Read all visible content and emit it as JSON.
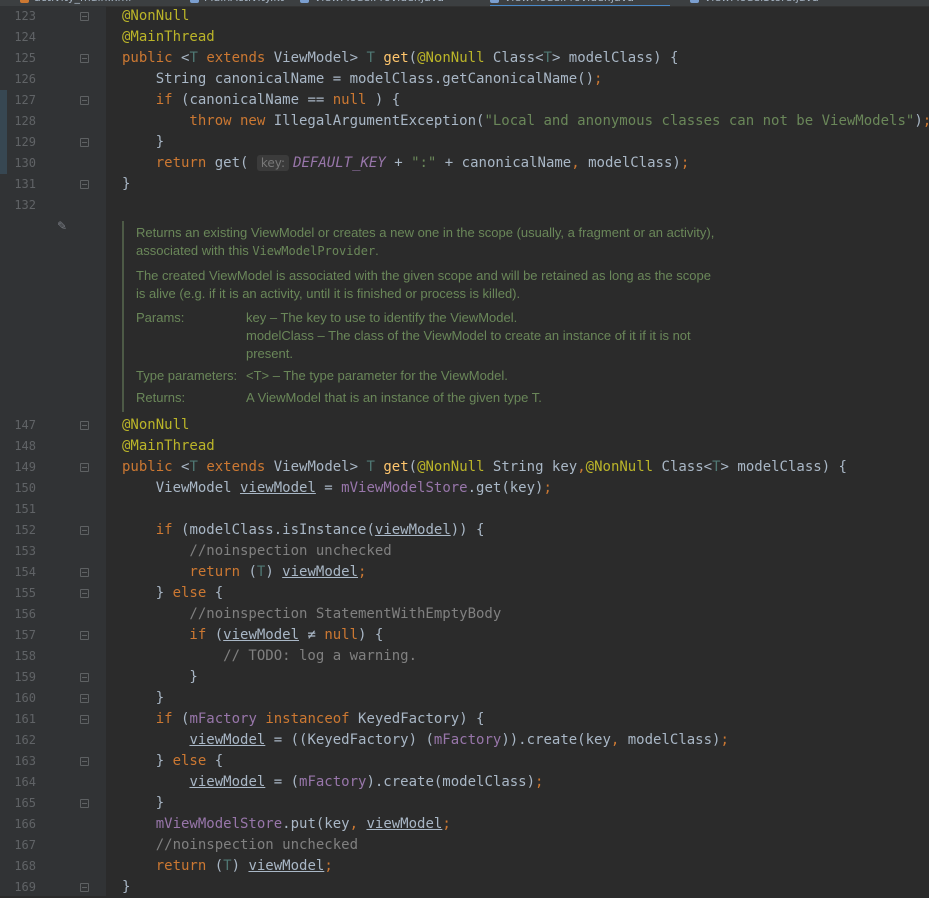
{
  "tabs": [
    {
      "label": "activity_main.xml",
      "color": "#cc7832",
      "active": false
    },
    {
      "label": "MainActivity.kt",
      "color": "#7b9fd0",
      "active": false
    },
    {
      "label": "ViewModelProvider.java",
      "color": "#7b9fd0",
      "active": false
    },
    {
      "label": "ViewModelProvider.java",
      "color": "#7b9fd0",
      "active": true
    },
    {
      "label": "ViewModelStore.java",
      "color": "#7b9fd0",
      "active": false
    }
  ],
  "colors": {
    "background": "#2b2b2b",
    "gutter": "#313335",
    "keyword": "#cc7832",
    "annotation": "#bbb529",
    "method": "#ffc66d",
    "string": "#6a8759",
    "field": "#9876aa",
    "comment": "#808080",
    "doc": "#6a8759"
  },
  "code_top": [
    {
      "n": "123",
      "tokens": [
        [
          "ann",
          "@NonNull"
        ]
      ]
    },
    {
      "n": "124",
      "tokens": [
        [
          "ann",
          "@MainThread"
        ]
      ]
    },
    {
      "n": "125",
      "tokens": [
        [
          "kw",
          "public "
        ],
        [
          "",
          "<"
        ],
        [
          "tp",
          "T"
        ],
        [
          "kw",
          " extends "
        ],
        [
          "",
          "ViewModel> "
        ],
        [
          "tp",
          "T"
        ],
        [
          "fn",
          " get"
        ],
        [
          "",
          "("
        ],
        [
          "ann",
          "@NonNull"
        ],
        [
          "",
          " Class<"
        ],
        [
          "tp",
          "T"
        ],
        [
          "",
          "> modelClass) {"
        ]
      ]
    },
    {
      "n": "126",
      "tokens": [
        [
          "",
          "    String canonicalName = modelClass.getCanonicalName()"
        ],
        [
          "kw",
          ";"
        ]
      ]
    },
    {
      "n": "127",
      "tokens": [
        [
          "kw",
          "    if "
        ],
        [
          "",
          "(canonicalName == "
        ],
        [
          "kw",
          "null"
        ],
        [
          "",
          " ) {"
        ]
      ]
    },
    {
      "n": "128",
      "tokens": [
        [
          "kw",
          "        throw new "
        ],
        [
          "",
          "IllegalArgumentException("
        ],
        [
          "str",
          "\"Local and anonymous classes can not be ViewModels\""
        ],
        [
          "",
          ")"
        ],
        [
          "kw",
          ";"
        ]
      ]
    },
    {
      "n": "129",
      "tokens": [
        [
          "",
          "    }"
        ]
      ]
    },
    {
      "n": "130",
      "tokens": [
        [
          "kw",
          "    return "
        ],
        [
          "",
          "get( "
        ],
        [
          "hint",
          "key:"
        ],
        [
          "fld ital",
          "DEFAULT_KEY"
        ],
        [
          "",
          " + "
        ],
        [
          "str",
          "\":\""
        ],
        [
          "",
          " + canonicalName"
        ],
        [
          "kw",
          ","
        ],
        [
          "",
          " modelClass)"
        ],
        [
          "kw",
          ";"
        ]
      ]
    },
    {
      "n": "131",
      "tokens": [
        [
          "",
          "}"
        ]
      ]
    },
    {
      "n": "132",
      "tokens": []
    }
  ],
  "doc": {
    "para1_a": "Returns an existing ViewModel or creates a new one in the scope (usually, a fragment or an activity),",
    "para1_b": "associated with this ",
    "para1_code": "ViewModelProvider",
    "para1_c": ".",
    "para2_a": "The created ViewModel is associated with the given scope and will be retained as long as the scope",
    "para2_b": "is alive (e.g. if it is an activity, until it is finished or process is killed).",
    "params_label": "Params:",
    "param1": "key – The key to use to identify the ViewModel.",
    "param2_a": "modelClass – The class of the ViewModel to create an instance of it if it is not",
    "param2_b": "present.",
    "typeparams_label": "Type parameters:",
    "typeparam1": "<T> – The type parameter for the ViewModel.",
    "returns_label": "Returns:",
    "returns_value": "A ViewModel that is an instance of the given type T."
  },
  "code_bottom": [
    {
      "n": "147",
      "tokens": [
        [
          "ann",
          "@NonNull"
        ]
      ]
    },
    {
      "n": "148",
      "tokens": [
        [
          "ann",
          "@MainThread"
        ]
      ]
    },
    {
      "n": "149",
      "tokens": [
        [
          "kw",
          "public "
        ],
        [
          "",
          "<"
        ],
        [
          "tp",
          "T"
        ],
        [
          "kw",
          " extends "
        ],
        [
          "",
          "ViewModel> "
        ],
        [
          "tp",
          "T"
        ],
        [
          "fn",
          " get"
        ],
        [
          "",
          "("
        ],
        [
          "ann",
          "@NonNull"
        ],
        [
          "",
          " String key"
        ],
        [
          "kw",
          ","
        ],
        [
          " ",
          ""
        ],
        [
          "ann",
          "@NonNull"
        ],
        [
          "",
          " Class<"
        ],
        [
          "tp",
          "T"
        ],
        [
          "",
          "> modelClass) {"
        ]
      ]
    },
    {
      "n": "150",
      "tokens": [
        [
          "",
          "    ViewModel "
        ],
        [
          "ul",
          "viewModel"
        ],
        [
          "",
          " = "
        ],
        [
          "fld",
          "mViewModelStore"
        ],
        [
          "",
          ".get(key)"
        ],
        [
          "kw",
          ";"
        ]
      ]
    },
    {
      "n": "151",
      "tokens": []
    },
    {
      "n": "152",
      "tokens": [
        [
          "kw",
          "    if "
        ],
        [
          "",
          "(modelClass.isInstance("
        ],
        [
          "ul",
          "viewModel"
        ],
        [
          "",
          ")) {"
        ]
      ]
    },
    {
      "n": "153",
      "tokens": [
        [
          "cmt",
          "        //noinspection unchecked"
        ]
      ]
    },
    {
      "n": "154",
      "tokens": [
        [
          "kw",
          "        return "
        ],
        [
          "",
          "("
        ],
        [
          "tp",
          "T"
        ],
        [
          "",
          ") "
        ],
        [
          "ul",
          "viewModel"
        ],
        [
          "kw",
          ";"
        ]
      ]
    },
    {
      "n": "155",
      "tokens": [
        [
          "",
          "    } "
        ],
        [
          "kw",
          "else "
        ],
        [
          "",
          "{"
        ]
      ]
    },
    {
      "n": "156",
      "tokens": [
        [
          "cmt",
          "        //noinspection StatementWithEmptyBody"
        ]
      ]
    },
    {
      "n": "157",
      "tokens": [
        [
          "kw",
          "        if "
        ],
        [
          "",
          "("
        ],
        [
          "ul",
          "viewModel"
        ],
        [
          "",
          " ≠ "
        ],
        [
          "kw",
          "null"
        ],
        [
          "",
          ") {"
        ]
      ]
    },
    {
      "n": "158",
      "tokens": [
        [
          "cmt",
          "            // TODO: log a warning."
        ]
      ]
    },
    {
      "n": "159",
      "tokens": [
        [
          "",
          "        }"
        ]
      ]
    },
    {
      "n": "160",
      "tokens": [
        [
          "",
          "    }"
        ]
      ]
    },
    {
      "n": "161",
      "tokens": [
        [
          "kw",
          "    if "
        ],
        [
          "",
          "("
        ],
        [
          "fld",
          "mFactory"
        ],
        [
          "kw",
          " instanceof "
        ],
        [
          "",
          "KeyedFactory) {"
        ]
      ]
    },
    {
      "n": "162",
      "tokens": [
        [
          "",
          "        "
        ],
        [
          "ul",
          "viewModel"
        ],
        [
          "",
          " = ((KeyedFactory) ("
        ],
        [
          "fld",
          "mFactory"
        ],
        [
          "",
          ")).create(key"
        ],
        [
          "kw",
          ","
        ],
        [
          "",
          " modelClass)"
        ],
        [
          "kw",
          ";"
        ]
      ]
    },
    {
      "n": "163",
      "tokens": [
        [
          "",
          "    } "
        ],
        [
          "kw",
          "else "
        ],
        [
          "",
          "{"
        ]
      ]
    },
    {
      "n": "164",
      "tokens": [
        [
          "",
          "        "
        ],
        [
          "ul",
          "viewModel"
        ],
        [
          "",
          " = ("
        ],
        [
          "fld",
          "mFactory"
        ],
        [
          "",
          ").create(modelClass)"
        ],
        [
          "kw",
          ";"
        ]
      ]
    },
    {
      "n": "165",
      "tokens": [
        [
          "",
          "    }"
        ]
      ]
    },
    {
      "n": "166",
      "tokens": [
        [
          "fld",
          "    mViewModelStore"
        ],
        [
          "",
          ".put(key"
        ],
        [
          "kw",
          ","
        ],
        [
          "",
          " "
        ],
        [
          "ul",
          "viewModel"
        ],
        [
          ")",
          ""
        ],
        [
          "kw",
          ";"
        ]
      ]
    },
    {
      "n": "167",
      "tokens": [
        [
          "cmt",
          "    //noinspection unchecked"
        ]
      ]
    },
    {
      "n": "168",
      "tokens": [
        [
          "kw",
          "    return "
        ],
        [
          "",
          "("
        ],
        [
          "tp",
          "T"
        ],
        [
          "",
          ") "
        ],
        [
          "ul",
          "viewModel"
        ],
        [
          "kw",
          ";"
        ]
      ]
    },
    {
      "n": "169",
      "tokens": [
        [
          "",
          "}"
        ]
      ]
    }
  ]
}
